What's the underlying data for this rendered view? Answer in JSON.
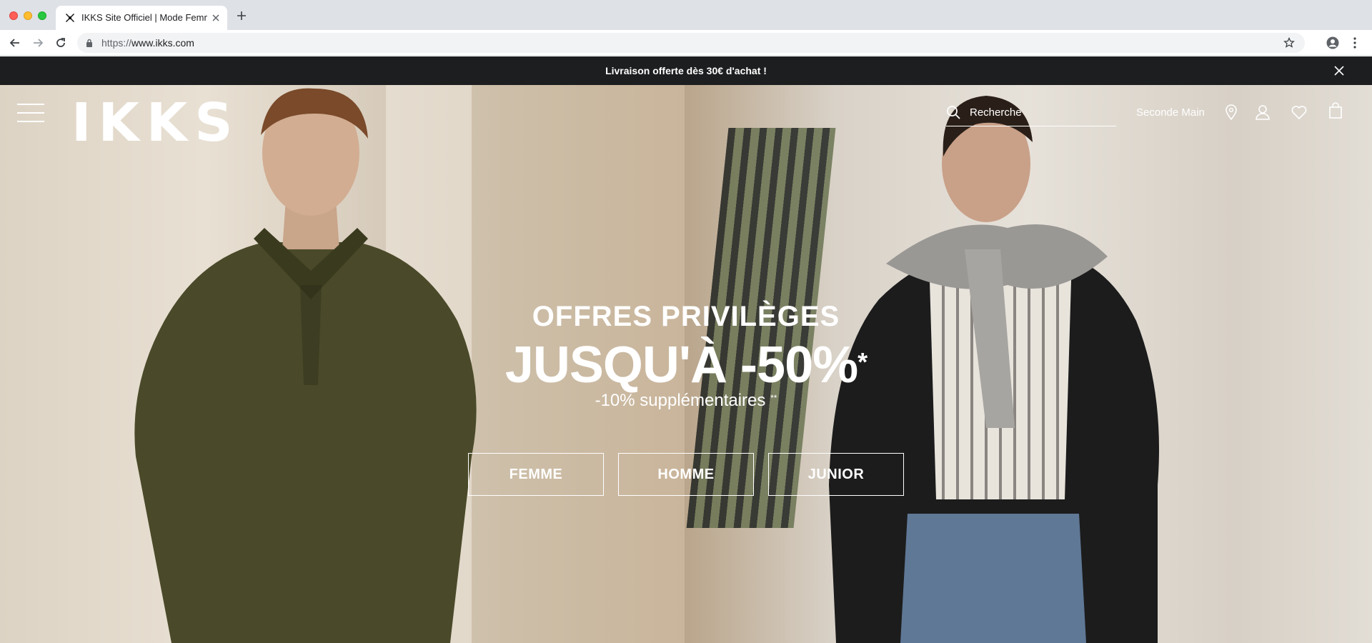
{
  "browser": {
    "tab_title": "IKKS Site Officiel | Mode Femme",
    "url_scheme": "https://",
    "url_host": "www.ikks.com",
    "icons": [
      "back-arrow-icon",
      "forward-arrow-icon",
      "reload-icon",
      "lock-icon",
      "star-icon",
      "profile-icon",
      "menu-icon",
      "tab-close-icon",
      "new-tab-icon"
    ]
  },
  "promo": {
    "text": "Livraison offerte dès 30€ d'achat !"
  },
  "header": {
    "logo": "IKKS",
    "search_placeholder": "Recherche",
    "seconde_main": "Seconde Main",
    "icons": [
      "hamburger-icon",
      "search-icon",
      "location-pin-icon",
      "account-icon",
      "heart-icon",
      "bag-icon"
    ]
  },
  "hero": {
    "line1": "OFFRES PRIVILÈGES",
    "line2": "JUSQU'À -50%",
    "line2_mark": "*",
    "line3": "-10% supplémentaires ",
    "line3_mark": "**",
    "buttons": [
      "FEMME",
      "HOMME",
      "JUNIOR"
    ]
  },
  "colors": {
    "banner_bg": "#1d1e20",
    "text_on_image": "#ffffff",
    "chrome_tabbar": "#dee1e6"
  }
}
